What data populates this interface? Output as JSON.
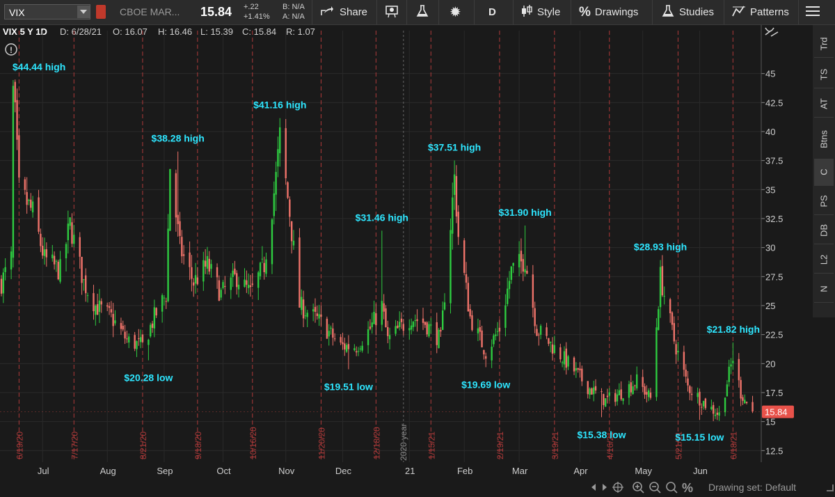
{
  "toolbar": {
    "symbol": "VIX",
    "description": "CBOE MAR...",
    "last_price": "15.84",
    "net_change": "+.22",
    "pct_change": "+1.41%",
    "bid": "B: N/A",
    "ask": "A: N/A",
    "share_label": "Share",
    "aggregation": "D",
    "style_label": "Style",
    "drawings_label": "Drawings",
    "studies_label": "Studies",
    "patterns_label": "Patterns"
  },
  "header": {
    "title": "VIX 5 Y 1D",
    "date": "D: 6/28/21",
    "open": "O: 16.07",
    "high": "H: 16.46",
    "low": "L: 15.39",
    "close": "C: 15.84",
    "range": "R: 1.07"
  },
  "sidebar": {
    "items": [
      {
        "label": "Trd"
      },
      {
        "label": "TS"
      },
      {
        "label": "AT"
      },
      {
        "label": "Btns"
      },
      {
        "label": "C"
      },
      {
        "label": "PS"
      },
      {
        "label": "DB"
      },
      {
        "label": "L2"
      },
      {
        "label": "N"
      }
    ]
  },
  "footer": {
    "drawing_set": "Drawing set: Default"
  },
  "colors": {
    "up": "#2ecc40",
    "down": "#f0736a",
    "annotation": "#2ee6ff",
    "event_line": "#b03a3a",
    "price_tag": "#e8524a"
  },
  "chart_data": {
    "type": "candlestick",
    "title": "VIX 5 Y 1D",
    "ylim": [
      11.5,
      47.5
    ],
    "y_ticks": [
      "45",
      "42.5",
      "40",
      "37.5",
      "35",
      "32.5",
      "30",
      "27.5",
      "25",
      "22.5",
      "20",
      "17.5",
      "15",
      "12.5"
    ],
    "x_range": [
      "2020-06-10",
      "2021-07-01"
    ],
    "month_ticks": [
      {
        "label": "Jul",
        "date": "2020-07-01"
      },
      {
        "label": "Aug",
        "date": "2020-08-03"
      },
      {
        "label": "Sep",
        "date": "2020-09-01"
      },
      {
        "label": "Oct",
        "date": "2020-10-01"
      },
      {
        "label": "Nov",
        "date": "2020-11-02"
      },
      {
        "label": "Dec",
        "date": "2020-12-01"
      },
      {
        "label": "21",
        "date": "2021-01-04"
      },
      {
        "label": "Feb",
        "date": "2021-02-01"
      },
      {
        "label": "Mar",
        "date": "2021-03-01"
      },
      {
        "label": "Apr",
        "date": "2021-04-01"
      },
      {
        "label": "May",
        "date": "2021-05-03"
      },
      {
        "label": "Jun",
        "date": "2021-06-01"
      }
    ],
    "event_lines": [
      {
        "label": "6/19/20",
        "date": "2020-06-19"
      },
      {
        "label": "7/17/20",
        "date": "2020-07-17"
      },
      {
        "label": "8/21/20",
        "date": "2020-08-21"
      },
      {
        "label": "9/18/20",
        "date": "2020-09-18"
      },
      {
        "label": "10/16/20",
        "date": "2020-10-16"
      },
      {
        "label": "11/20/20",
        "date": "2020-11-20"
      },
      {
        "label": "12/18/20",
        "date": "2020-12-18"
      },
      {
        "label": "1/15/21",
        "date": "2021-01-15"
      },
      {
        "label": "2/19/21",
        "date": "2021-02-19"
      },
      {
        "label": "3/19/21",
        "date": "2021-03-19"
      },
      {
        "label": "4/16/21",
        "date": "2021-04-16"
      },
      {
        "label": "5/21/21",
        "date": "2021-05-21"
      },
      {
        "label": "6/18/21",
        "date": "2021-06-18"
      }
    ],
    "year_divider": {
      "label": "2020 year",
      "date": "2021-01-01"
    },
    "anchors": [
      {
        "date": "2020-06-10",
        "value": 27.0
      },
      {
        "date": "2020-06-15",
        "value": 29.0
      },
      {
        "date": "2020-06-16",
        "value": 44.4
      },
      {
        "date": "2020-06-19",
        "value": 35.0
      },
      {
        "date": "2020-06-26",
        "value": 33.0
      },
      {
        "date": "2020-07-02",
        "value": 29.0
      },
      {
        "date": "2020-07-10",
        "value": 28.0
      },
      {
        "date": "2020-07-15",
        "value": 32.0
      },
      {
        "date": "2020-07-22",
        "value": 27.0
      },
      {
        "date": "2020-07-28",
        "value": 25.0
      },
      {
        "date": "2020-08-05",
        "value": 24.0
      },
      {
        "date": "2020-08-13",
        "value": 22.0
      },
      {
        "date": "2020-08-21",
        "value": 21.5
      },
      {
        "date": "2020-08-27",
        "value": 24.0
      },
      {
        "date": "2020-09-02",
        "value": 26.0
      },
      {
        "date": "2020-09-04",
        "value": 37.0
      },
      {
        "date": "2020-09-09",
        "value": 30.0
      },
      {
        "date": "2020-09-16",
        "value": 27.0
      },
      {
        "date": "2020-09-23",
        "value": 28.5
      },
      {
        "date": "2020-09-30",
        "value": 26.0
      },
      {
        "date": "2020-10-08",
        "value": 27.5
      },
      {
        "date": "2020-10-15",
        "value": 26.0
      },
      {
        "date": "2020-10-22",
        "value": 28.5
      },
      {
        "date": "2020-10-28",
        "value": 36.0
      },
      {
        "date": "2020-10-30",
        "value": 39.5
      },
      {
        "date": "2020-11-04",
        "value": 33.0
      },
      {
        "date": "2020-11-09",
        "value": 25.0
      },
      {
        "date": "2020-11-20",
        "value": 23.5
      },
      {
        "date": "2020-11-30",
        "value": 21.5
      },
      {
        "date": "2020-12-08",
        "value": 21.5
      },
      {
        "date": "2020-12-15",
        "value": 23.0
      },
      {
        "date": "2020-12-21",
        "value": 25.0
      },
      {
        "date": "2020-12-24",
        "value": 22.0
      },
      {
        "date": "2021-01-05",
        "value": 24.0
      },
      {
        "date": "2021-01-12",
        "value": 23.5
      },
      {
        "date": "2021-01-20",
        "value": 22.0
      },
      {
        "date": "2021-01-27",
        "value": 36.0
      },
      {
        "date": "2021-01-29",
        "value": 31.0
      },
      {
        "date": "2021-02-04",
        "value": 24.0
      },
      {
        "date": "2021-02-12",
        "value": 21.0
      },
      {
        "date": "2021-02-19",
        "value": 23.0
      },
      {
        "date": "2021-02-25",
        "value": 28.0
      },
      {
        "date": "2021-03-04",
        "value": 29.0
      },
      {
        "date": "2021-03-10",
        "value": 23.0
      },
      {
        "date": "2021-03-18",
        "value": 21.5
      },
      {
        "date": "2021-03-26",
        "value": 20.0
      },
      {
        "date": "2021-04-05",
        "value": 18.0
      },
      {
        "date": "2021-04-14",
        "value": 16.8
      },
      {
        "date": "2021-04-22",
        "value": 17.5
      },
      {
        "date": "2021-04-30",
        "value": 18.5
      },
      {
        "date": "2021-05-07",
        "value": 17.0
      },
      {
        "date": "2021-05-12",
        "value": 27.5
      },
      {
        "date": "2021-05-19",
        "value": 22.0
      },
      {
        "date": "2021-05-26",
        "value": 18.0
      },
      {
        "date": "2021-06-04",
        "value": 16.5
      },
      {
        "date": "2021-06-11",
        "value": 15.6
      },
      {
        "date": "2021-06-18",
        "value": 20.5
      },
      {
        "date": "2021-06-22",
        "value": 17.5
      },
      {
        "date": "2021-06-28",
        "value": 15.8
      }
    ],
    "extremes": [
      {
        "date": "2020-06-16",
        "value": 44.44
      },
      {
        "date": "2020-08-24",
        "value": 20.28
      },
      {
        "date": "2020-09-08",
        "value": 38.28
      },
      {
        "date": "2020-10-30",
        "value": 41.16
      },
      {
        "date": "2020-12-04",
        "value": 19.51
      },
      {
        "date": "2020-12-21",
        "value": 31.46
      },
      {
        "date": "2021-01-27",
        "value": 37.51
      },
      {
        "date": "2021-02-12",
        "value": 19.69
      },
      {
        "date": "2021-03-04",
        "value": 31.9
      },
      {
        "date": "2021-04-12",
        "value": 15.38
      },
      {
        "date": "2021-05-12",
        "value": 28.93
      },
      {
        "date": "2021-06-01",
        "value": 15.15
      },
      {
        "date": "2021-06-18",
        "value": 21.82
      }
    ],
    "annotations": [
      {
        "text": "$44.44 high",
        "date": "2020-06-16",
        "value": 44.44,
        "kind": "high"
      },
      {
        "text": "$20.28 low",
        "date": "2020-08-24",
        "value": 20.28,
        "kind": "low"
      },
      {
        "text": "$38.28 high",
        "date": "2020-09-08",
        "value": 38.28,
        "kind": "high"
      },
      {
        "text": "$41.16 high",
        "date": "2020-10-30",
        "value": 41.16,
        "kind": "high"
      },
      {
        "text": "$19.51 low",
        "date": "2020-12-04",
        "value": 19.51,
        "kind": "low"
      },
      {
        "text": "$31.46 high",
        "date": "2020-12-21",
        "value": 31.46,
        "kind": "high"
      },
      {
        "text": "$37.51 high",
        "date": "2021-01-27",
        "value": 37.51,
        "kind": "high"
      },
      {
        "text": "$19.69 low",
        "date": "2021-02-12",
        "value": 19.69,
        "kind": "low"
      },
      {
        "text": "$31.90 high",
        "date": "2021-03-04",
        "value": 31.9,
        "kind": "high"
      },
      {
        "text": "$15.38 low",
        "date": "2021-04-12",
        "value": 15.38,
        "kind": "low"
      },
      {
        "text": "$28.93 high",
        "date": "2021-05-12",
        "value": 28.93,
        "kind": "high"
      },
      {
        "text": "$15.15 low",
        "date": "2021-06-01",
        "value": 15.15,
        "kind": "low"
      },
      {
        "text": "$21.82 high",
        "date": "2021-06-18",
        "value": 21.82,
        "kind": "high"
      }
    ],
    "last_value": {
      "label": "15.84",
      "value": 15.84
    }
  }
}
